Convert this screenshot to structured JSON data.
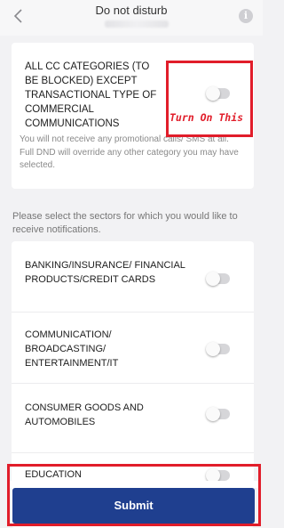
{
  "header": {
    "title": "Do not disturb",
    "back_icon": "chevron-left-icon",
    "info_icon": "info-icon",
    "info_symbol": "i"
  },
  "full_dnd": {
    "label": "ALL CC CATEGORIES (TO BE BLOCKED) EXCEPT TRANSACTIONAL TYPE OF COMMERCIAL COMMUNICATIONS",
    "description": "You will not receive any promotional calls/ SMS at all. Full DND will override any other category you may have selected.",
    "enabled": false
  },
  "annotation": {
    "text": "Turn On This",
    "color": "#e11d2a"
  },
  "sectors": {
    "prompt": "Please select the sectors for which you would like to receive notifications.",
    "items": [
      {
        "label": "BANKING/INSURANCE/ FINANCIAL PRODUCTS/CREDIT CARDS",
        "enabled": false
      },
      {
        "label": "COMMUNICATION/ BROADCASTING/ ENTERTAINMENT/IT",
        "enabled": false
      },
      {
        "label": "CONSUMER GOODS AND AUTOMOBILES",
        "enabled": false
      },
      {
        "label": "EDUCATION",
        "enabled": false
      }
    ]
  },
  "submit": {
    "label": "Submit",
    "color": "#1f3f8f"
  }
}
